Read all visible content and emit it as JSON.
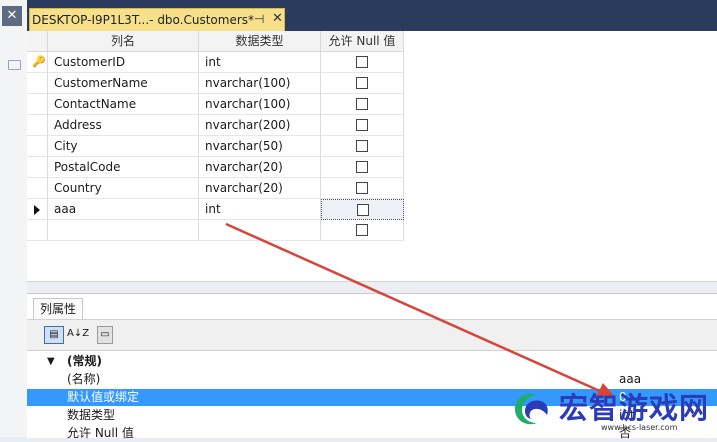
{
  "tab": {
    "title": "DESKTOP-I9P1L3T...- dbo.Customers*",
    "pin_glyph": "⊣",
    "close_glyph": "✕"
  },
  "gutter": {
    "close_glyph": "✕"
  },
  "grid": {
    "headers": [
      "列名",
      "数据类型",
      "允许 Null 值"
    ],
    "rows": [
      {
        "name": "CustomerID",
        "type": "int",
        "allow_null": false,
        "primary_key": true
      },
      {
        "name": "CustomerName",
        "type": "nvarchar(100)",
        "allow_null": false
      },
      {
        "name": "ContactName",
        "type": "nvarchar(100)",
        "allow_null": false
      },
      {
        "name": "Address",
        "type": "nvarchar(200)",
        "allow_null": false
      },
      {
        "name": "City",
        "type": "nvarchar(50)",
        "allow_null": false
      },
      {
        "name": "PostalCode",
        "type": "nvarchar(20)",
        "allow_null": false
      },
      {
        "name": "Country",
        "type": "nvarchar(20)",
        "allow_null": false
      },
      {
        "name": "aaa",
        "type": "int",
        "allow_null": false,
        "current": true
      },
      {
        "name": "",
        "type": "",
        "allow_null": false,
        "new_row": true
      }
    ]
  },
  "properties": {
    "tab_label": "列属性",
    "toolbar": {
      "categorized_glyph": "▤",
      "alphabetical_glyph": "A↓Z",
      "property_pages_glyph": "▭"
    },
    "category": {
      "label": "(常规)",
      "chevron": "▼"
    },
    "rows": [
      {
        "label": "(名称)",
        "value": "aaa"
      },
      {
        "label": "默认值或绑定",
        "value": "0",
        "selected": true
      },
      {
        "label": "数据类型",
        "value": "int"
      },
      {
        "label": "允许 Null 值",
        "value": "否"
      }
    ]
  },
  "watermark": {
    "text": "宏智游戏网",
    "url": "www.hcs-laser.com"
  },
  "colors": {
    "tab_active": "#f6e08a",
    "tabstrip": "#2b3b5e",
    "selection": "#3399ff",
    "annotation_arrow": "#d9443a",
    "watermark_blue": "#2c3bb8",
    "watermark_green": "#1fae6a"
  }
}
